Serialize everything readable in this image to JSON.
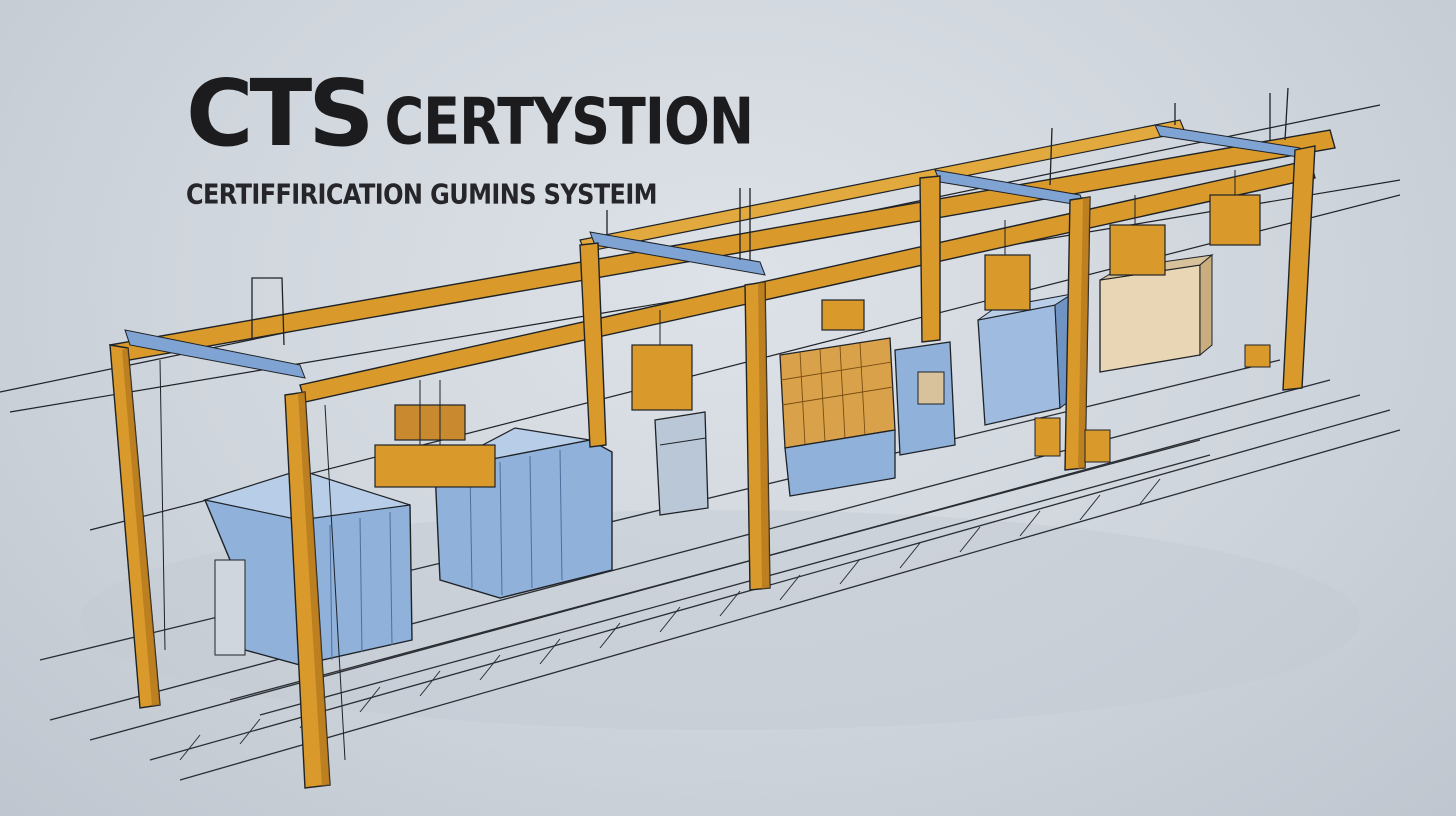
{
  "brand": {
    "mark": "CTS",
    "wordmark": "CERTYSTION",
    "tagline": "CERTIFFIRICATION GUMINS SYSTEIM"
  },
  "illustration": {
    "subject": "gantry-crane-production-line",
    "colors": {
      "background": "#d3d9df",
      "frame": "#d99a2b",
      "frame_shadow": "#a9701b",
      "container": "#8fb1da",
      "container_dark": "#5f82b3",
      "crate": "#c98a2f",
      "ink": "#1f2328"
    }
  }
}
